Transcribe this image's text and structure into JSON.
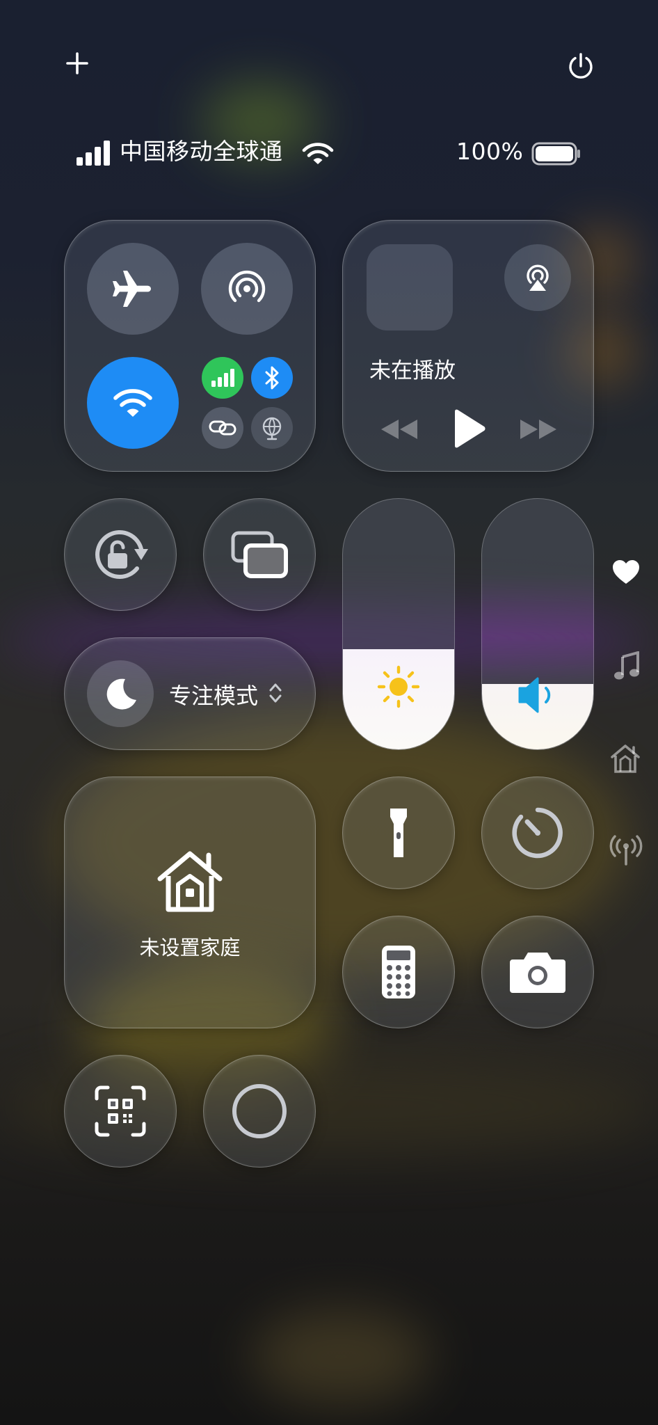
{
  "status": {
    "carrier": "中国移动全球通",
    "battery": "100%",
    "battery_level": 1.0
  },
  "connectivity": {
    "airplane": "airplane-icon",
    "hotspot": "hotspot-icon",
    "wifi": "wifi-icon",
    "cellular": "cellular-data-icon",
    "bluetooth": "bluetooth-icon",
    "link": "link-icon",
    "vpn": "globe-icon"
  },
  "media": {
    "status": "未在播放",
    "controls": [
      "rewind-icon",
      "play-icon",
      "fast-forward-icon"
    ]
  },
  "focus": {
    "label": "专注模式"
  },
  "home": {
    "label": "未设置家庭"
  },
  "brightness": {
    "level": 0.4
  },
  "volume": {
    "level": 0.26
  },
  "colors": {
    "wifi_active": "#1e8cf5",
    "cellular_active": "#2fc55a",
    "bluetooth_active": "#1e8cf5",
    "sun": "#f6c21a",
    "speaker": "#1aa3e0"
  },
  "side_icons": [
    "heart-icon",
    "music-note-icon",
    "home-icon",
    "antenna-icon"
  ]
}
